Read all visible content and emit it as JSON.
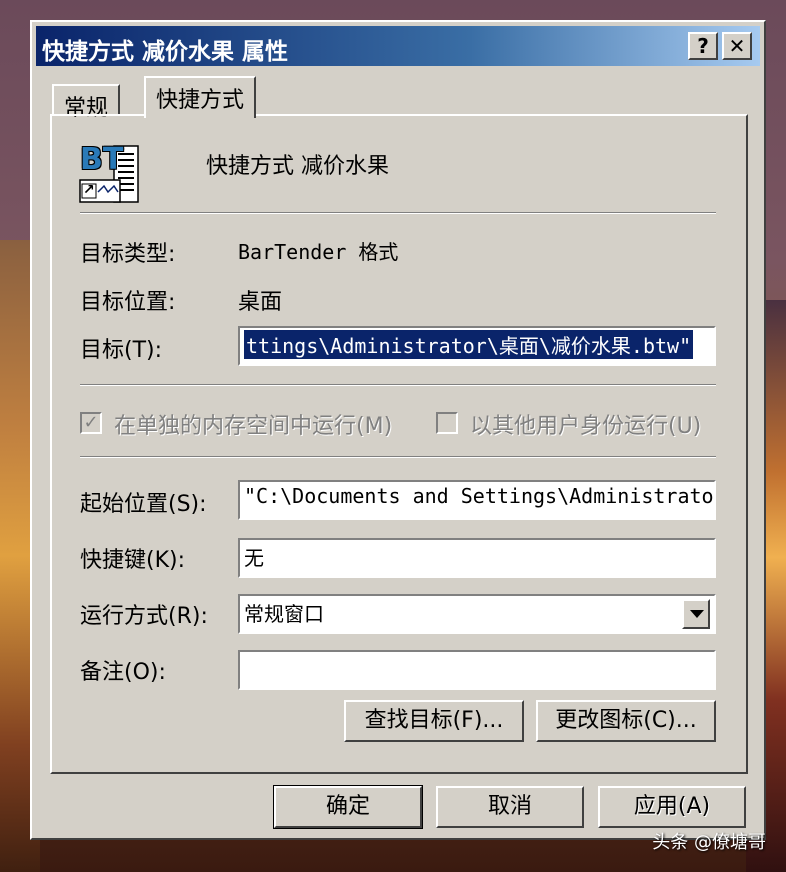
{
  "window": {
    "title": "快捷方式 减价水果 属性",
    "help_glyph": "?",
    "close_glyph": "✕"
  },
  "tabs": [
    {
      "label": "常规"
    },
    {
      "label": "快捷方式"
    }
  ],
  "shortcut": {
    "name": "快捷方式 减价水果",
    "icon_text": "BT",
    "icon_arrow": "↗"
  },
  "target_type": {
    "label": "目标类型:",
    "value": "BarTender 格式"
  },
  "target_location": {
    "label": "目标位置:",
    "value": "桌面"
  },
  "target": {
    "label": "目标(T):",
    "value": "ttings\\Administrator\\桌面\\减价水果.btw\""
  },
  "options": {
    "separate_memory": {
      "label": "在单独的内存空间中运行(M)",
      "check_glyph": "✓"
    },
    "run_as": {
      "label": "以其他用户身份运行(U)"
    }
  },
  "start_in": {
    "label": "起始位置(S):",
    "value": "\"C:\\Documents and Settings\\Administrato"
  },
  "hotkey": {
    "label": "快捷键(K):",
    "value": "无"
  },
  "run": {
    "label": "运行方式(R):",
    "value": "常规窗口"
  },
  "comment": {
    "label": "备注(O):",
    "value": ""
  },
  "buttons": {
    "find_target": "查找目标(F)...",
    "change_icon": "更改图标(C)...",
    "ok": "确定",
    "cancel": "取消",
    "apply": "应用(A)"
  },
  "watermark": "头条 @僚塘哥",
  "colors": {
    "face": "#d4d0c8",
    "title_start": "#0a246a",
    "title_end": "#a6caf0",
    "selection": "#0a246a"
  }
}
